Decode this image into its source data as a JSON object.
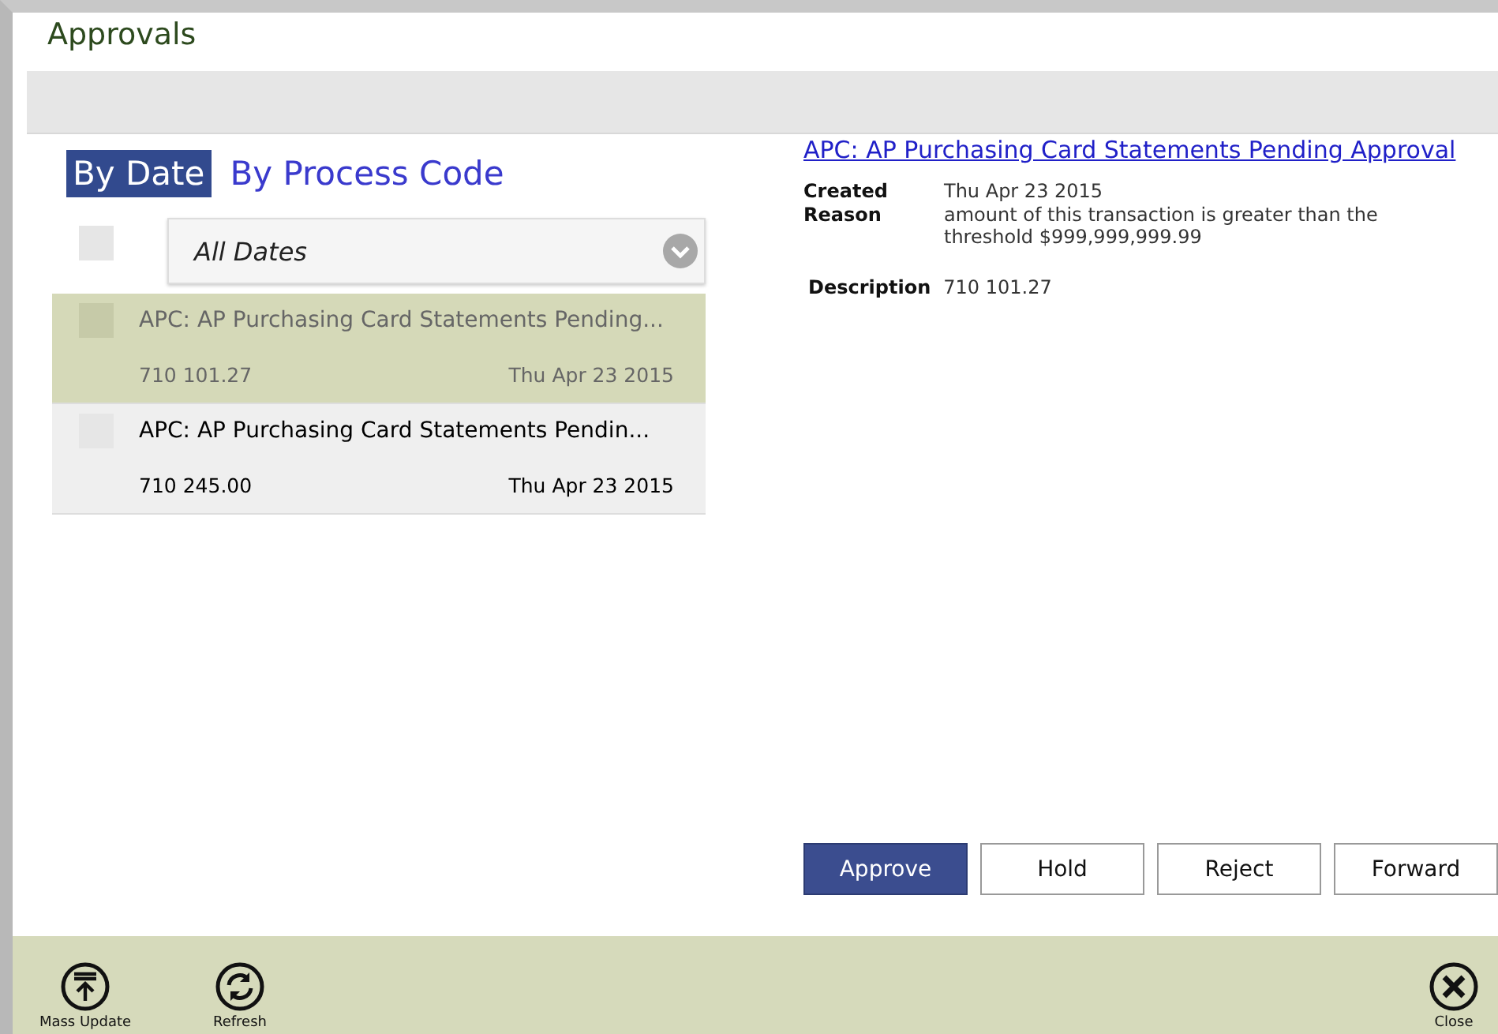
{
  "window": {
    "title": "Approvals"
  },
  "tabs": [
    {
      "label": "By Date",
      "selected": true
    },
    {
      "label": "By Process Code",
      "selected": false
    }
  ],
  "select_all": {
    "checked": false
  },
  "filter": {
    "value": "All Dates"
  },
  "items": [
    {
      "title": "APC: AP Purchasing Card Statements Pending...",
      "amount": "710 101.27",
      "date": "Thu Apr 23 2015",
      "selected": true,
      "checked": false
    },
    {
      "title": "APC: AP Purchasing Card Statements Pendin...",
      "amount": "710 245.00",
      "date": "Thu Apr 23 2015",
      "selected": false,
      "checked": false
    }
  ],
  "detail": {
    "link": "APC: AP Purchasing Card Statements Pending Approval",
    "fields": [
      {
        "label": "Created",
        "value": "Thu Apr 23 2015"
      },
      {
        "label": "Reason",
        "value": "amount of this transaction is greater than the threshold $999,999,999.99"
      }
    ],
    "description": {
      "label": "Description",
      "value": "710 101.27"
    }
  },
  "actions": [
    {
      "label": "Approve",
      "kind": "primary"
    },
    {
      "label": "Hold",
      "kind": "default"
    },
    {
      "label": "Reject",
      "kind": "default"
    },
    {
      "label": "Forward",
      "kind": "default"
    }
  ],
  "app_bar": [
    {
      "label": "Mass Update",
      "kind": "mass-update"
    },
    {
      "label": "Refresh",
      "kind": "refresh"
    },
    {
      "label": "Close",
      "kind": "close"
    }
  ]
}
